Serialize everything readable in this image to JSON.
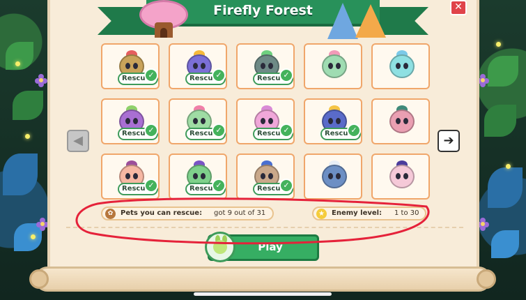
{
  "header": {
    "title": "Firefly Forest",
    "close_label": "✕"
  },
  "navigation": {
    "prev_label": "◀",
    "next_label": "➔"
  },
  "pets": [
    {
      "status": "Rescued",
      "body_color": "#c9a35a",
      "tuft_color": "#e55e5e"
    },
    {
      "status": "Rescued",
      "body_color": "#7b6fd6",
      "tuft_color": "#f6b93a"
    },
    {
      "status": "Rescued",
      "body_color": "#6e8a86",
      "tuft_color": "#6ed07f"
    },
    {
      "status": "",
      "body_color": "#9fdcb2",
      "tuft_color": "#f29ab8"
    },
    {
      "status": "",
      "body_color": "#8ee0e2",
      "tuft_color": "#7bc9e8"
    },
    {
      "status": "Rescued",
      "body_color": "#a96fd3",
      "tuft_color": "#8fd06a"
    },
    {
      "status": "Rescued",
      "body_color": "#9fdca4",
      "tuft_color": "#f07fa8"
    },
    {
      "status": "Rescued",
      "body_color": "#f0a7d9",
      "tuft_color": "#d98ad6"
    },
    {
      "status": "Rescued",
      "body_color": "#5a6bc9",
      "tuft_color": "#f5c445"
    },
    {
      "status": "",
      "body_color": "#ea9fb2",
      "tuft_color": "#3f8a7a"
    },
    {
      "status": "Rescued",
      "body_color": "#f6b7a3",
      "tuft_color": "#9c4f9a"
    },
    {
      "status": "Rescued",
      "body_color": "#7ed08b",
      "tuft_color": "#7a54c5"
    },
    {
      "status": "Rescued",
      "body_color": "#c9a88a",
      "tuft_color": "#4a6fd0"
    },
    {
      "status": "",
      "body_color": "#6c8fc4",
      "tuft_color": "#e7eef6"
    },
    {
      "status": "",
      "body_color": "#f5c9d8",
      "tuft_color": "#4b3c9c"
    }
  ],
  "info": {
    "rescue_label": "Pets you can rescue:",
    "rescue_value": "got 9 out of 31",
    "enemy_label": "Enemy level:",
    "enemy_value": "1 to 30"
  },
  "actions": {
    "play_label": "Play"
  },
  "colors": {
    "banner_green": "#28915a",
    "card_border": "#f0a66a",
    "rescued_green": "#44b25c",
    "annotation_red": "#e5223a"
  }
}
